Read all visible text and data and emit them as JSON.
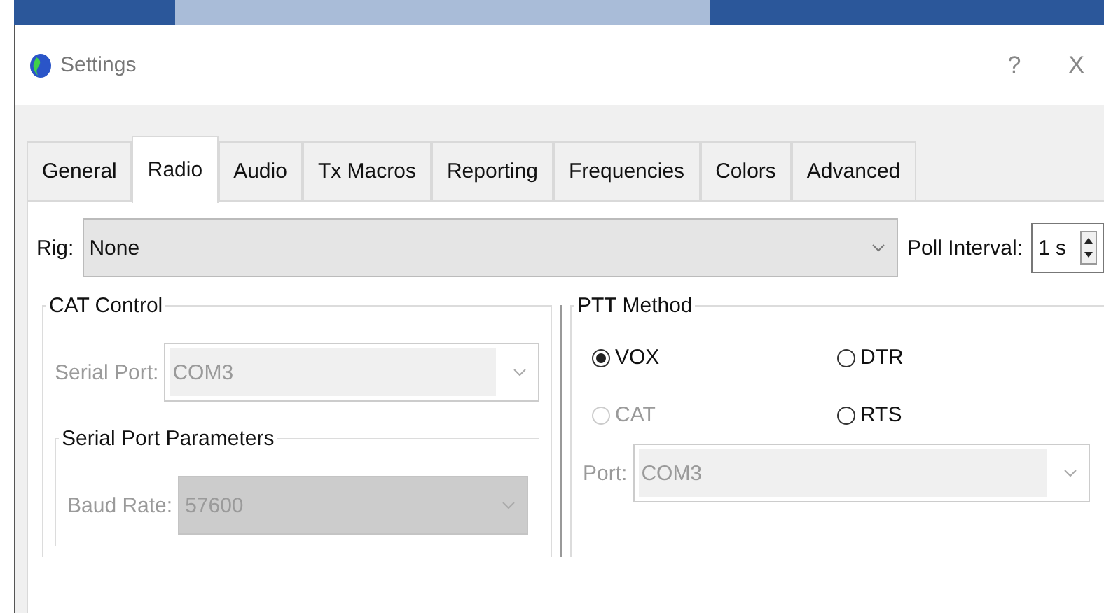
{
  "window": {
    "title": "Settings",
    "help": "?",
    "close": "X"
  },
  "tabs": [
    {
      "label": "General",
      "selected": false
    },
    {
      "label": "Radio",
      "selected": true
    },
    {
      "label": "Audio",
      "selected": false
    },
    {
      "label": "Tx Macros",
      "selected": false
    },
    {
      "label": "Reporting",
      "selected": false
    },
    {
      "label": "Frequencies",
      "selected": false
    },
    {
      "label": "Colors",
      "selected": false
    },
    {
      "label": "Advanced",
      "selected": false
    }
  ],
  "rig": {
    "label": "Rig:",
    "value": "None"
  },
  "poll_interval": {
    "label": "Poll Interval:",
    "value": "1 s"
  },
  "cat_control": {
    "title": "CAT Control",
    "serial_port": {
      "label": "Serial Port:",
      "value": "COM3",
      "disabled": true
    },
    "serial_port_parameters": {
      "title": "Serial Port Parameters",
      "baud_rate": {
        "label": "Baud Rate:",
        "value": "57600",
        "disabled": true
      }
    }
  },
  "ptt_method": {
    "title": "PTT Method",
    "options": [
      {
        "label": "VOX",
        "selected": true,
        "disabled": false
      },
      {
        "label": "DTR",
        "selected": false,
        "disabled": false
      },
      {
        "label": "CAT",
        "selected": false,
        "disabled": true
      },
      {
        "label": "RTS",
        "selected": false,
        "disabled": false
      }
    ],
    "port": {
      "label": "Port:",
      "value": "COM3",
      "disabled": true
    }
  }
}
